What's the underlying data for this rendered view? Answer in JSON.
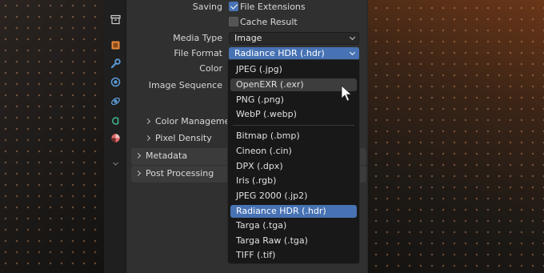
{
  "output_properties": {
    "saving_label": "Saving",
    "file_extensions_label": "File Extensions",
    "file_extensions_checked": true,
    "cache_result_label": "Cache Result",
    "cache_result_checked": false,
    "media_type_label": "Media Type",
    "media_type_value": "Image",
    "file_format_label": "File Format",
    "file_format_value": "Radiance HDR (.hdr)",
    "color_label": "Color",
    "image_sequence_label": "Image Sequence",
    "color_management_label": "Color Management",
    "pixel_density_label": "Pixel Density",
    "metadata_label": "Metadata",
    "post_processing_label": "Post Processing"
  },
  "file_format_menu": {
    "group1": [
      "JPEG (.jpg)",
      "OpenEXR (.exr)",
      "PNG (.png)",
      "WebP (.webp)"
    ],
    "group2": [
      "Bitmap (.bmp)",
      "Cineon (.cin)",
      "DPX (.dpx)",
      "Iris (.rgb)",
      "JPEG 2000 (.jp2)",
      "Radiance HDR (.hdr)",
      "Targa (.tga)",
      "Targa Raw (.tga)",
      "TIFF (.tif)"
    ],
    "hovered": "OpenEXR (.exr)",
    "selected": "Radiance HDR (.hdr)"
  },
  "side_tabs": [
    {
      "icon": "archive-icon",
      "color": "#cfcfcf"
    },
    {
      "icon": "object-icon",
      "color": "#e8893a"
    },
    {
      "icon": "wrench-icon",
      "color": "#5b9bd8"
    },
    {
      "icon": "particles-icon",
      "color": "#5b9bd8"
    },
    {
      "icon": "physics-icon",
      "color": "#5b9bd8"
    },
    {
      "icon": "constraints-icon",
      "color": "#3fb28f"
    },
    {
      "icon": "material-icon",
      "color": "#e06a6a"
    },
    {
      "icon": "chevron-down-icon",
      "color": "#7a7a7a"
    }
  ],
  "colors": {
    "accent": "#4772b3",
    "panel_bg": "#303030",
    "menu_bg": "#181818"
  }
}
